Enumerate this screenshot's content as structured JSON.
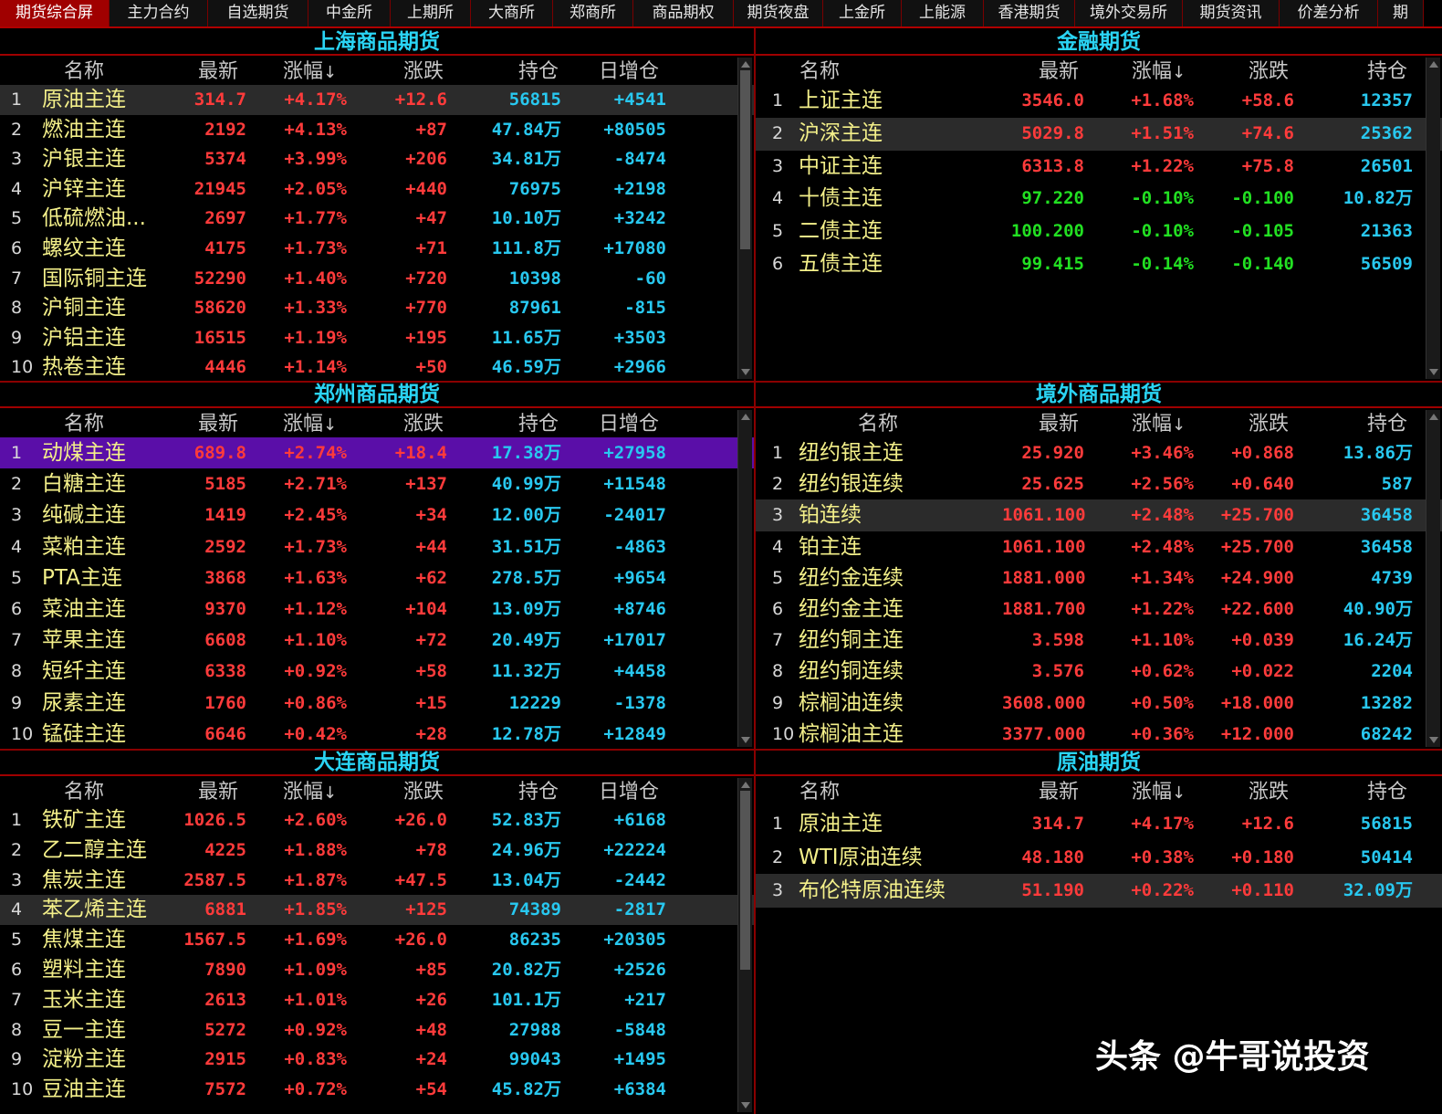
{
  "tabs": [
    "期货综合屏",
    "主力合约",
    "自选期货",
    "中金所",
    "上期所",
    "大商所",
    "郑商所",
    "商品期权",
    "期货夜盘",
    "上金所",
    "上能源",
    "香港期货",
    "境外交易所",
    "期货资讯",
    "价差分析",
    "期"
  ],
  "headers6": [
    "名称",
    "最新",
    "涨幅",
    "涨跌",
    "持仓",
    "日增仓"
  ],
  "headers5": [
    "名称",
    "最新",
    "涨幅",
    "涨跌",
    "持仓"
  ],
  "sort_arrow": "↓",
  "watermark": "头条 @牛哥说投资",
  "panels": {
    "shanghai": {
      "title": "上海商品期货",
      "rows": [
        {
          "i": "1",
          "name": "原油主连",
          "last": "314.7",
          "pct": "+4.17%",
          "chg": "+12.6",
          "oi": "56815",
          "add": "+4541",
          "dir": "up"
        },
        {
          "i": "2",
          "name": "燃油主连",
          "last": "2192",
          "pct": "+4.13%",
          "chg": "+87",
          "oi": "47.84万",
          "add": "+80505",
          "dir": "up"
        },
        {
          "i": "3",
          "name": "沪银主连",
          "last": "5374",
          "pct": "+3.99%",
          "chg": "+206",
          "oi": "34.81万",
          "add": "-8474",
          "dir": "up"
        },
        {
          "i": "4",
          "name": "沪锌主连",
          "last": "21945",
          "pct": "+2.05%",
          "chg": "+440",
          "oi": "76975",
          "add": "+2198",
          "dir": "up"
        },
        {
          "i": "5",
          "name": "低硫燃油...",
          "last": "2697",
          "pct": "+1.77%",
          "chg": "+47",
          "oi": "10.10万",
          "add": "+3242",
          "dir": "up"
        },
        {
          "i": "6",
          "name": "螺纹主连",
          "last": "4175",
          "pct": "+1.73%",
          "chg": "+71",
          "oi": "111.8万",
          "add": "+17080",
          "dir": "up"
        },
        {
          "i": "7",
          "name": "国际铜主连",
          "last": "52290",
          "pct": "+1.40%",
          "chg": "+720",
          "oi": "10398",
          "add": "-60",
          "dir": "up"
        },
        {
          "i": "8",
          "name": "沪铜主连",
          "last": "58620",
          "pct": "+1.33%",
          "chg": "+770",
          "oi": "87961",
          "add": "-815",
          "dir": "up"
        },
        {
          "i": "9",
          "name": "沪铝主连",
          "last": "16515",
          "pct": "+1.19%",
          "chg": "+195",
          "oi": "11.65万",
          "add": "+3503",
          "dir": "up"
        },
        {
          "i": "10",
          "name": "热卷主连",
          "last": "4446",
          "pct": "+1.14%",
          "chg": "+50",
          "oi": "46.59万",
          "add": "+2966",
          "dir": "up"
        }
      ]
    },
    "zhengzhou": {
      "title": "郑州商品期货",
      "rows": [
        {
          "i": "1",
          "name": "动煤主连",
          "last": "689.8",
          "pct": "+2.74%",
          "chg": "+18.4",
          "oi": "17.38万",
          "add": "+27958",
          "dir": "up"
        },
        {
          "i": "2",
          "name": "白糖主连",
          "last": "5185",
          "pct": "+2.71%",
          "chg": "+137",
          "oi": "40.99万",
          "add": "+11548",
          "dir": "up"
        },
        {
          "i": "3",
          "name": "纯碱主连",
          "last": "1419",
          "pct": "+2.45%",
          "chg": "+34",
          "oi": "12.00万",
          "add": "-24017",
          "dir": "up"
        },
        {
          "i": "4",
          "name": "菜粕主连",
          "last": "2592",
          "pct": "+1.73%",
          "chg": "+44",
          "oi": "31.51万",
          "add": "-4863",
          "dir": "up"
        },
        {
          "i": "5",
          "name": "PTA主连",
          "last": "3868",
          "pct": "+1.63%",
          "chg": "+62",
          "oi": "278.5万",
          "add": "+9654",
          "dir": "up"
        },
        {
          "i": "6",
          "name": "菜油主连",
          "last": "9370",
          "pct": "+1.12%",
          "chg": "+104",
          "oi": "13.09万",
          "add": "+8746",
          "dir": "up"
        },
        {
          "i": "7",
          "name": "苹果主连",
          "last": "6608",
          "pct": "+1.10%",
          "chg": "+72",
          "oi": "20.49万",
          "add": "+17017",
          "dir": "up"
        },
        {
          "i": "8",
          "name": "短纤主连",
          "last": "6338",
          "pct": "+0.92%",
          "chg": "+58",
          "oi": "11.32万",
          "add": "+4458",
          "dir": "up"
        },
        {
          "i": "9",
          "name": "尿素主连",
          "last": "1760",
          "pct": "+0.86%",
          "chg": "+15",
          "oi": "12229",
          "add": "-1378",
          "dir": "up"
        },
        {
          "i": "10",
          "name": "锰硅主连",
          "last": "6646",
          "pct": "+0.42%",
          "chg": "+28",
          "oi": "12.78万",
          "add": "+12849",
          "dir": "up"
        }
      ]
    },
    "dalian": {
      "title": "大连商品期货",
      "rows": [
        {
          "i": "1",
          "name": "铁矿主连",
          "last": "1026.5",
          "pct": "+2.60%",
          "chg": "+26.0",
          "oi": "52.83万",
          "add": "+6168",
          "dir": "up"
        },
        {
          "i": "2",
          "name": "乙二醇主连",
          "last": "4225",
          "pct": "+1.88%",
          "chg": "+78",
          "oi": "24.96万",
          "add": "+22224",
          "dir": "up"
        },
        {
          "i": "3",
          "name": "焦炭主连",
          "last": "2587.5",
          "pct": "+1.87%",
          "chg": "+47.5",
          "oi": "13.04万",
          "add": "-2442",
          "dir": "up"
        },
        {
          "i": "4",
          "name": "苯乙烯主连",
          "last": "6881",
          "pct": "+1.85%",
          "chg": "+125",
          "oi": "74389",
          "add": "-2817",
          "dir": "up"
        },
        {
          "i": "5",
          "name": "焦煤主连",
          "last": "1567.5",
          "pct": "+1.69%",
          "chg": "+26.0",
          "oi": "86235",
          "add": "+20305",
          "dir": "up"
        },
        {
          "i": "6",
          "name": "塑料主连",
          "last": "7890",
          "pct": "+1.09%",
          "chg": "+85",
          "oi": "20.82万",
          "add": "+2526",
          "dir": "up"
        },
        {
          "i": "7",
          "name": "玉米主连",
          "last": "2613",
          "pct": "+1.01%",
          "chg": "+26",
          "oi": "101.1万",
          "add": "+217",
          "dir": "up"
        },
        {
          "i": "8",
          "name": "豆一主连",
          "last": "5272",
          "pct": "+0.92%",
          "chg": "+48",
          "oi": "27988",
          "add": "-5848",
          "dir": "up"
        },
        {
          "i": "9",
          "name": "淀粉主连",
          "last": "2915",
          "pct": "+0.83%",
          "chg": "+24",
          "oi": "99043",
          "add": "+1495",
          "dir": "up"
        },
        {
          "i": "10",
          "name": "豆油主连",
          "last": "7572",
          "pct": "+0.72%",
          "chg": "+54",
          "oi": "45.82万",
          "add": "+6384",
          "dir": "up"
        }
      ]
    },
    "finance": {
      "title": "金融期货",
      "rows": [
        {
          "i": "1",
          "name": "上证主连",
          "last": "3546.0",
          "pct": "+1.68%",
          "chg": "+58.6",
          "oi": "12357",
          "dir": "up"
        },
        {
          "i": "2",
          "name": "沪深主连",
          "last": "5029.8",
          "pct": "+1.51%",
          "chg": "+74.6",
          "oi": "25362",
          "dir": "up"
        },
        {
          "i": "3",
          "name": "中证主连",
          "last": "6313.8",
          "pct": "+1.22%",
          "chg": "+75.8",
          "oi": "26501",
          "dir": "up"
        },
        {
          "i": "4",
          "name": "十债主连",
          "last": "97.220",
          "pct": "-0.10%",
          "chg": "-0.100",
          "oi": "10.82万",
          "dir": "dn"
        },
        {
          "i": "5",
          "name": "二债主连",
          "last": "100.200",
          "pct": "-0.10%",
          "chg": "-0.105",
          "oi": "21363",
          "dir": "dn"
        },
        {
          "i": "6",
          "name": "五债主连",
          "last": "99.415",
          "pct": "-0.14%",
          "chg": "-0.140",
          "oi": "56509",
          "dir": "dn"
        }
      ]
    },
    "overseas": {
      "title": "境外商品期货",
      "rows": [
        {
          "i": "1",
          "name": "纽约银主连",
          "last": "25.920",
          "pct": "+3.46%",
          "chg": "+0.868",
          "oi": "13.86万",
          "dir": "up"
        },
        {
          "i": "2",
          "name": "纽约银连续",
          "last": "25.625",
          "pct": "+2.56%",
          "chg": "+0.640",
          "oi": "587",
          "dir": "up"
        },
        {
          "i": "3",
          "name": "铂连续",
          "last": "1061.100",
          "pct": "+2.48%",
          "chg": "+25.700",
          "oi": "36458",
          "dir": "up"
        },
        {
          "i": "4",
          "name": "铂主连",
          "last": "1061.100",
          "pct": "+2.48%",
          "chg": "+25.700",
          "oi": "36458",
          "dir": "up"
        },
        {
          "i": "5",
          "name": "纽约金连续",
          "last": "1881.000",
          "pct": "+1.34%",
          "chg": "+24.900",
          "oi": "4739",
          "dir": "up"
        },
        {
          "i": "6",
          "name": "纽约金主连",
          "last": "1881.700",
          "pct": "+1.22%",
          "chg": "+22.600",
          "oi": "40.90万",
          "dir": "up"
        },
        {
          "i": "7",
          "name": "纽约铜主连",
          "last": "3.598",
          "pct": "+1.10%",
          "chg": "+0.039",
          "oi": "16.24万",
          "dir": "up"
        },
        {
          "i": "8",
          "name": "纽约铜连续",
          "last": "3.576",
          "pct": "+0.62%",
          "chg": "+0.022",
          "oi": "2204",
          "dir": "up"
        },
        {
          "i": "9",
          "name": "棕榈油连续",
          "last": "3608.000",
          "pct": "+0.50%",
          "chg": "+18.000",
          "oi": "13282",
          "dir": "up"
        },
        {
          "i": "10",
          "name": "棕榈油主连",
          "last": "3377.000",
          "pct": "+0.36%",
          "chg": "+12.000",
          "oi": "68242",
          "dir": "up"
        }
      ]
    },
    "crude": {
      "title": "原油期货",
      "rows": [
        {
          "i": "1",
          "name": "原油主连",
          "last": "314.7",
          "pct": "+4.17%",
          "chg": "+12.6",
          "oi": "56815",
          "dir": "up"
        },
        {
          "i": "2",
          "name": "WTI原油连续",
          "last": "48.180",
          "pct": "+0.38%",
          "chg": "+0.180",
          "oi": "50414",
          "dir": "up"
        },
        {
          "i": "3",
          "name": "布伦特原油连续",
          "last": "51.190",
          "pct": "+0.22%",
          "chg": "+0.110",
          "oi": "32.09万",
          "dir": "up"
        }
      ]
    }
  }
}
